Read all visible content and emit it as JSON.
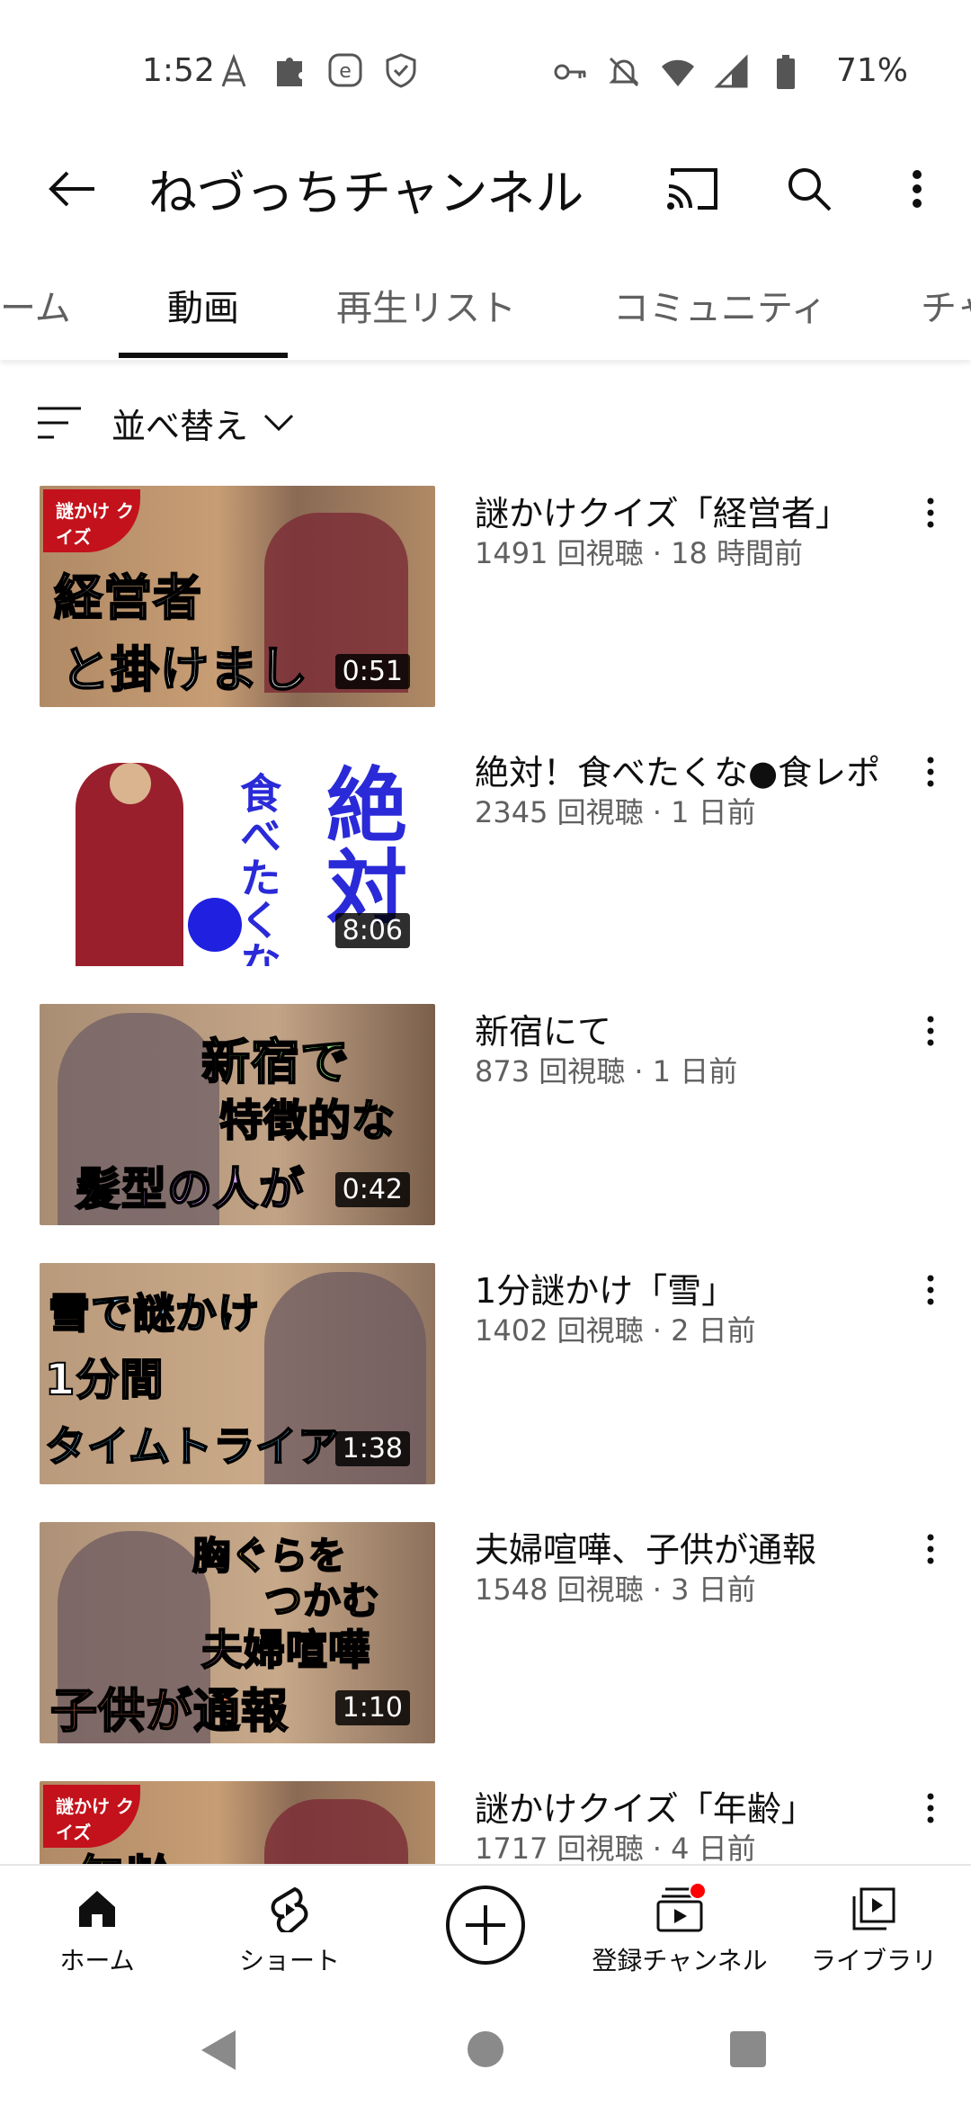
{
  "status": {
    "time": "1:52",
    "battery": "71%"
  },
  "header": {
    "title": "ねづっちチャンネル"
  },
  "tabs": [
    {
      "label": "ーム"
    },
    {
      "label": "動画"
    },
    {
      "label": "再生リスト"
    },
    {
      "label": "コミュニティ"
    },
    {
      "label": "チャ"
    }
  ],
  "sort": {
    "label": "並べ替え"
  },
  "videos": [
    {
      "title": "謎かけクイズ「経営者」",
      "meta": "1491 回視聴 · 18 時間前",
      "duration": "0:51",
      "thumb_lines": [
        "経営者",
        "と掛けまし"
      ],
      "thumb_tag": "謎かけ クイズ"
    },
    {
      "title": "絶対！食べたくな●食レポ",
      "meta": "2345 回視聴 · 1 日前",
      "duration": "8:06",
      "thumb_lines": [
        "絶対",
        "食べたくな"
      ]
    },
    {
      "title": "新宿にて",
      "meta": "873 回視聴 · 1 日前",
      "duration": "0:42",
      "thumb_lines": [
        "新宿で",
        "特徴的な",
        "髪型の人が"
      ]
    },
    {
      "title": "1分謎かけ「雪」",
      "meta": "1402 回視聴 · 2 日前",
      "duration": "1:38",
      "thumb_lines": [
        "雪で謎かけ",
        "1分間",
        "タイムトライア"
      ]
    },
    {
      "title": "夫婦喧嘩、子供が通報",
      "meta": "1548 回視聴 · 3 日前",
      "duration": "1:10",
      "thumb_lines": [
        "胸ぐらを",
        "つかむ",
        "夫婦喧嘩",
        "子供が通報"
      ]
    },
    {
      "title": "謎かけクイズ「年齢」",
      "meta": "1717 回視聴 · 4 日前",
      "thumb_lines": [
        "年齢"
      ],
      "thumb_tag": "謎かけ クイズ"
    }
  ],
  "bottom_nav": [
    {
      "label": "ホーム"
    },
    {
      "label": "ショート"
    },
    {
      "label": "登録チャンネル"
    },
    {
      "label": "ライブラリ"
    }
  ],
  "colors": {
    "active_text": "#0f0f0f",
    "inactive_text": "#606060",
    "badge": "#ff0000"
  }
}
